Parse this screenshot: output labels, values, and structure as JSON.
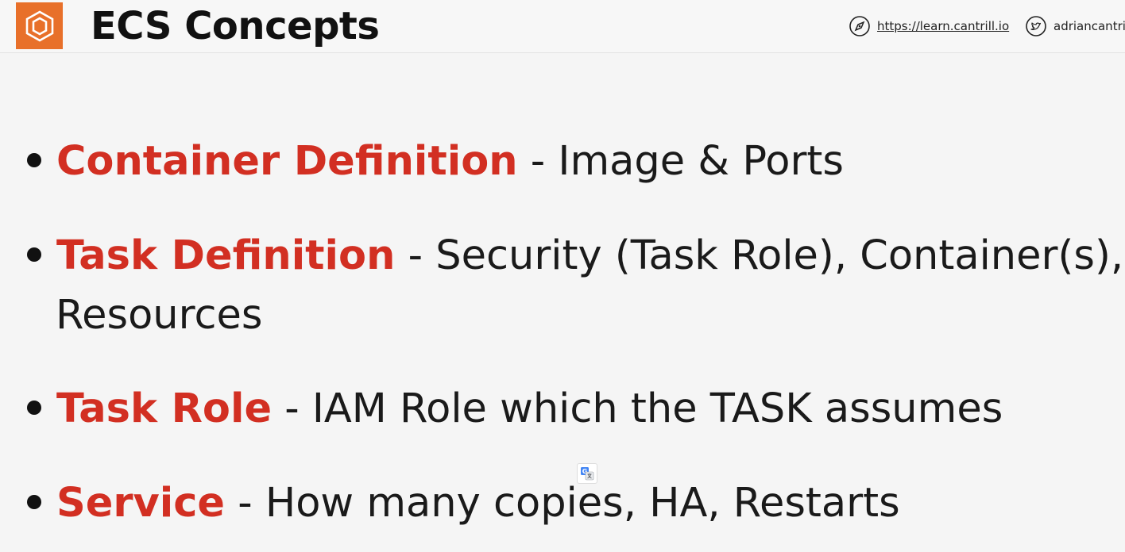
{
  "header": {
    "title": "ECS Concepts",
    "site_link": "https://learn.cantrill.io",
    "twitter_handle": "adriancantril",
    "logo_icon": "ecs-hexagon-icon",
    "site_icon": "compass-icon",
    "twitter_icon": "twitter-bird-icon"
  },
  "bullets": [
    {
      "term": "Container Definition",
      "desc": " - Image & Ports"
    },
    {
      "term": "Task Definition",
      "desc": " - Security (Task Role), Container(s),",
      "cont": "Resources"
    },
    {
      "term": "Task Role",
      "desc": " - IAM Role which the TASK assumes"
    },
    {
      "term": "Service",
      "desc": " - How many copies, HA, Restarts"
    }
  ],
  "colors": {
    "accent": "#d22f22",
    "logo": "#e8702a"
  },
  "overlay": {
    "translate_icon": "google-translate-icon"
  }
}
